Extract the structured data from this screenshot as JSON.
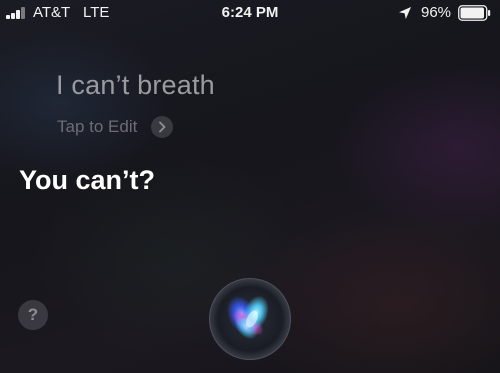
{
  "status_bar": {
    "carrier": "AT&T",
    "network": "LTE",
    "time": "6:24 PM",
    "battery_percent": "96%",
    "battery_level": 0.96,
    "signal_bars_filled": 3,
    "signal_bars_total": 4
  },
  "siri": {
    "utterance": "I can’t breath",
    "edit_label": "Tap to Edit",
    "response": "You can’t?",
    "help_label": "?"
  },
  "icons": {
    "location": "location-arrow-icon",
    "chevron": "chevron-right-icon",
    "orb": "siri-orb-icon"
  },
  "colors": {
    "text_primary": "#ffffff",
    "text_secondary": "#9a9aa0",
    "text_tertiary": "#6d6d74",
    "orb_cyan": "#4fd1ff",
    "orb_magenta": "#e04fd8",
    "orb_blue": "#3a5bff"
  }
}
